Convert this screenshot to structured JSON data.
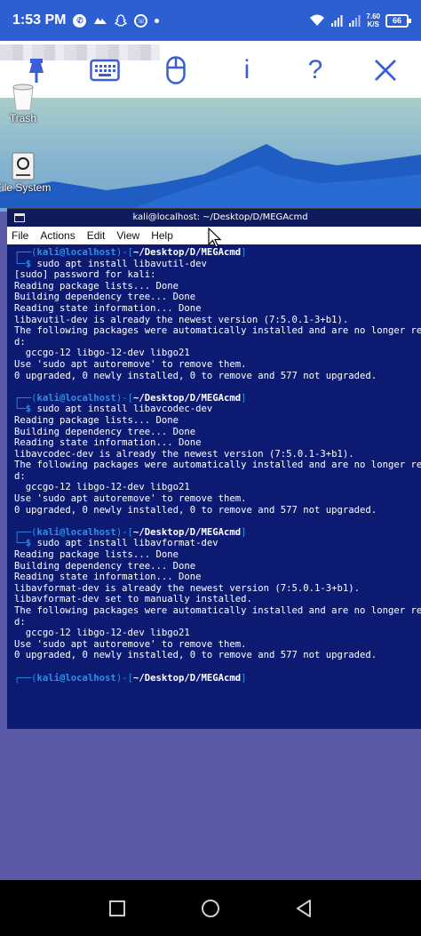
{
  "status_bar": {
    "time": "1:53 PM",
    "net_speed_value": "7.60",
    "net_speed_unit": "K/S",
    "battery": "66",
    "left_icons": [
      "whatsapp-icon",
      "cloud-icon",
      "snapchat-icon",
      "phone-icon",
      "dot-icon"
    ],
    "right_icons": [
      "wifi-icon",
      "signal-icon",
      "signal-icon",
      "battery-icon"
    ]
  },
  "viewer_toolbar": {
    "info_label": "i",
    "help_label": "?",
    "icons": [
      "pin-icon",
      "keyboard-icon",
      "mouse-icon",
      "info-icon",
      "help-icon",
      "close-icon"
    ],
    "accent": "#3b5ed6"
  },
  "desktop": {
    "icons": [
      {
        "label": "Trash",
        "icon": "trash-icon"
      },
      {
        "label": "File System",
        "icon": "drive-icon"
      }
    ]
  },
  "terminal": {
    "title": "kali@localhost: ~/Desktop/D/MEGAcmd",
    "menu": [
      "File",
      "Actions",
      "Edit",
      "View",
      "Help"
    ],
    "prompt": {
      "user": "kali",
      "at": "@",
      "host": "localhost",
      "path": "~/Desktop/D/MEGAcmd",
      "dollar": "$"
    },
    "blocks": [
      {
        "command": "sudo apt install libavutil-dev",
        "output": [
          "[sudo] password for kali:",
          "Reading package lists... Done",
          "Building dependency tree... Done",
          "Reading state information... Done",
          "libavutil-dev is already the newest version (7:5.0.1-3+b1).",
          "The following packages were automatically installed and are no longer requ",
          "d:",
          "  gccgo-12 libgo-12-dev libgo21",
          "Use 'sudo apt autoremove' to remove them.",
          "0 upgraded, 0 newly installed, 0 to remove and 577 not upgraded.",
          ""
        ]
      },
      {
        "command": "sudo apt install libavcodec-dev",
        "output": [
          "Reading package lists... Done",
          "Building dependency tree... Done",
          "Reading state information... Done",
          "libavcodec-dev is already the newest version (7:5.0.1-3+b1).",
          "The following packages were automatically installed and are no longer requ",
          "d:",
          "  gccgo-12 libgo-12-dev libgo21",
          "Use 'sudo apt autoremove' to remove them.",
          "0 upgraded, 0 newly installed, 0 to remove and 577 not upgraded.",
          ""
        ]
      },
      {
        "command": "sudo apt install libavformat-dev",
        "output": [
          "Reading package lists... Done",
          "Building dependency tree... Done",
          "Reading state information... Done",
          "libavformat-dev is already the newest version (7:5.0.1-3+b1).",
          "libavformat-dev set to manually installed.",
          "The following packages were automatically installed and are no longer requ",
          "d:",
          "  gccgo-12 libgo-12-dev libgo21",
          "Use 'sudo apt autoremove' to remove them.",
          "0 upgraded, 0 newly installed, 0 to remove and 577 not upgraded.",
          ""
        ]
      }
    ],
    "colors": {
      "background": "#0c1a72",
      "prompt": "#2d8fe8",
      "text": "#ffffff"
    }
  },
  "nav_bar": {
    "buttons": [
      "recents-button",
      "home-button",
      "back-button"
    ]
  }
}
